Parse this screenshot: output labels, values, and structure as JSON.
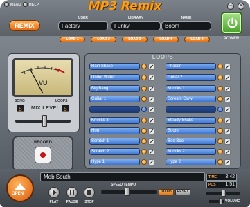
{
  "header": {
    "menu_label": "MENU",
    "help_label": "HELP",
    "title": "MP3 Remix",
    "minimize_glyph": "–",
    "close_glyph": "×"
  },
  "remix_button": "REMIX",
  "fields": [
    {
      "label": "USER",
      "value": "Factory"
    },
    {
      "label": "LIBRARY",
      "value": "Funky"
    },
    {
      "label": "NAME",
      "value": "Boom"
    }
  ],
  "presets": [
    "LOAD 1",
    "LOAD 2",
    "LOAD 3",
    "LOAD 4",
    "LOAD 5"
  ],
  "power_label": "POWER",
  "meter": {
    "label": "VU",
    "song_label": "SONG",
    "loops_label": "LOOPS",
    "song_value": "5",
    "loops_value": "5",
    "mix_level_label": "MIX LEVEL"
  },
  "loops_header": "LOOPS",
  "loops_left": [
    "Rain Shake",
    "Under Water",
    "Big Bang",
    "Guitar 1",
    "",
    "Knocks 3",
    "Horn",
    "Scratch 1",
    "Scratch 2",
    "Hype 1"
  ],
  "loops_right": [
    "Phaser",
    "Guitar 2",
    "Knocks 1",
    "Scream Oww",
    "",
    "Steady Shake",
    "Boom",
    "Boo Boo",
    "Knocks 2",
    "Hype 2"
  ],
  "record_label": "RECORD",
  "transport": {
    "open_label": "OPEN",
    "song_title": "Mob South",
    "play_label": "PLAY",
    "pause_label": "PAUSE",
    "stop_label": "STOP",
    "speed_label": "SPEED/TEMPO",
    "percent": "100%",
    "reset_label": "RESET",
    "time_label": "TIME",
    "time_value": "3:42",
    "pos_label": "POS",
    "pos_value": "1:51",
    "volume_label": "VOLUME"
  }
}
